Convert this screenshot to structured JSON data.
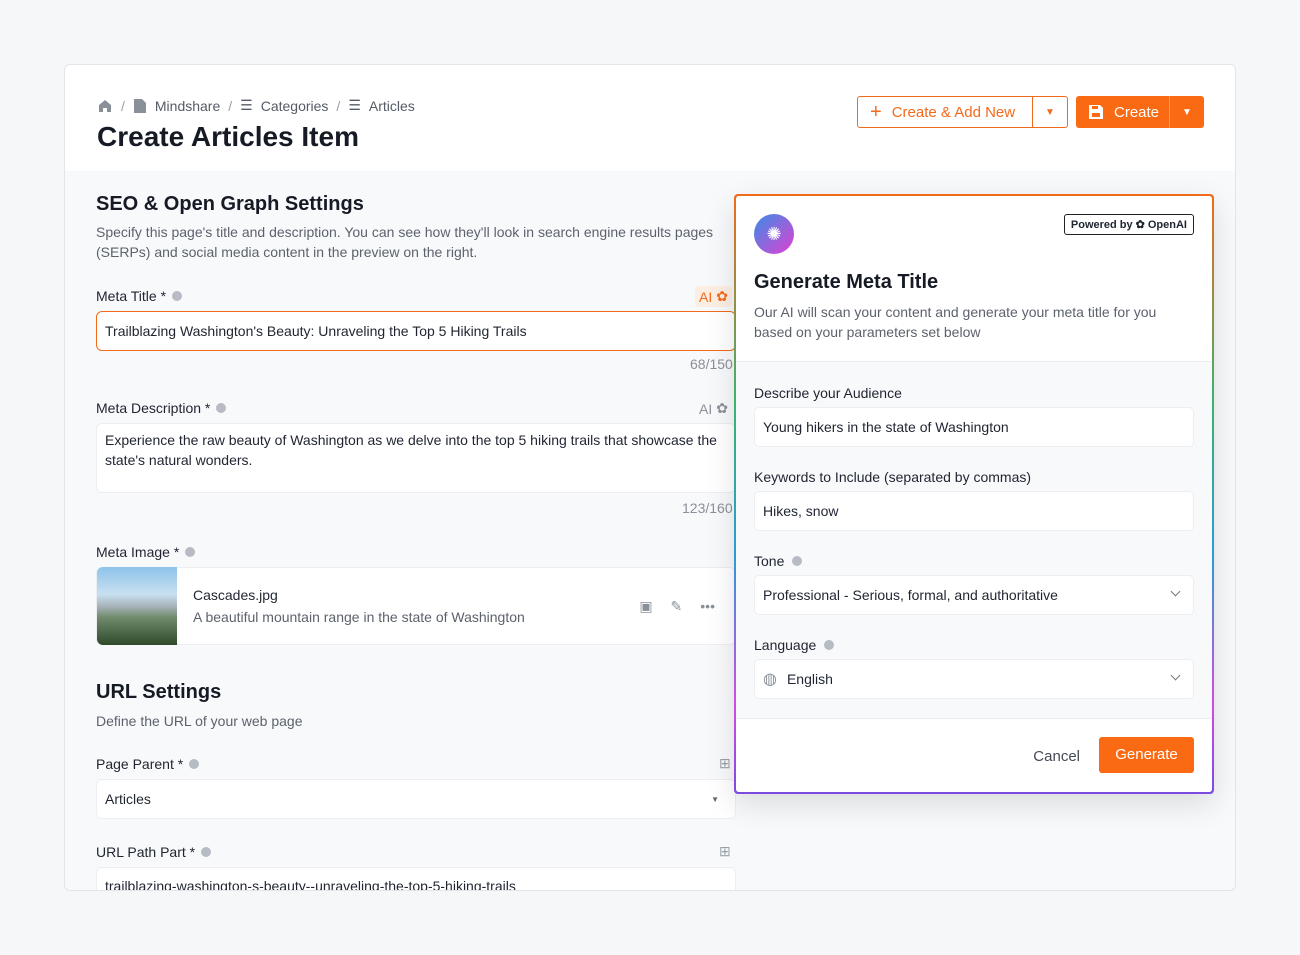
{
  "breadcrumb": [
    "Mindshare",
    "Categories",
    "Articles"
  ],
  "page_title": "Create Articles Item",
  "actions": {
    "create_add_new": "Create & Add New",
    "create": "Create"
  },
  "seo": {
    "title": "SEO & Open Graph Settings",
    "description": "Specify this page's title and description. You can see how they'll look in search engine results pages (SERPs) and social media content in the preview on the right.",
    "meta_title": {
      "label": "Meta Title *",
      "ai": "AI",
      "value": "Trailblazing Washington's Beauty: Unraveling the Top 5 Hiking Trails",
      "counter": "68/150"
    },
    "meta_description": {
      "label": "Meta Description *",
      "ai": "AI",
      "value": "Experience the raw beauty of Washington as we delve into the top 5 hiking trails that showcase the state's natural wonders.",
      "counter": "123/160"
    },
    "meta_image": {
      "label": "Meta Image *",
      "filename": "Cascades.jpg",
      "caption": "A beautiful mountain range in the state of Washington"
    }
  },
  "url": {
    "title": "URL Settings",
    "description": "Define the URL of your web page",
    "page_parent": {
      "label": "Page Parent *",
      "value": "Articles"
    },
    "path_part": {
      "label": "URL Path Part *",
      "value": "trailblazing-washington-s-beauty--unraveling-the-top-5-hiking-trails"
    }
  },
  "modal": {
    "powered_by": "Powered by",
    "brand": "OpenAI",
    "title": "Generate Meta Title",
    "description": "Our AI will scan your content and generate your meta title for you based on your parameters set below",
    "audience": {
      "label": "Describe your Audience",
      "value": "Young hikers in the state of Washington"
    },
    "keywords": {
      "label": "Keywords to Include (separated by commas)",
      "value": "Hikes, snow"
    },
    "tone": {
      "label": "Tone",
      "value": "Professional - Serious, formal, and authoritative"
    },
    "language": {
      "label": "Language",
      "value": "English"
    },
    "cancel": "Cancel",
    "generate": "Generate"
  },
  "colors": {
    "accent": "#f96a12"
  }
}
